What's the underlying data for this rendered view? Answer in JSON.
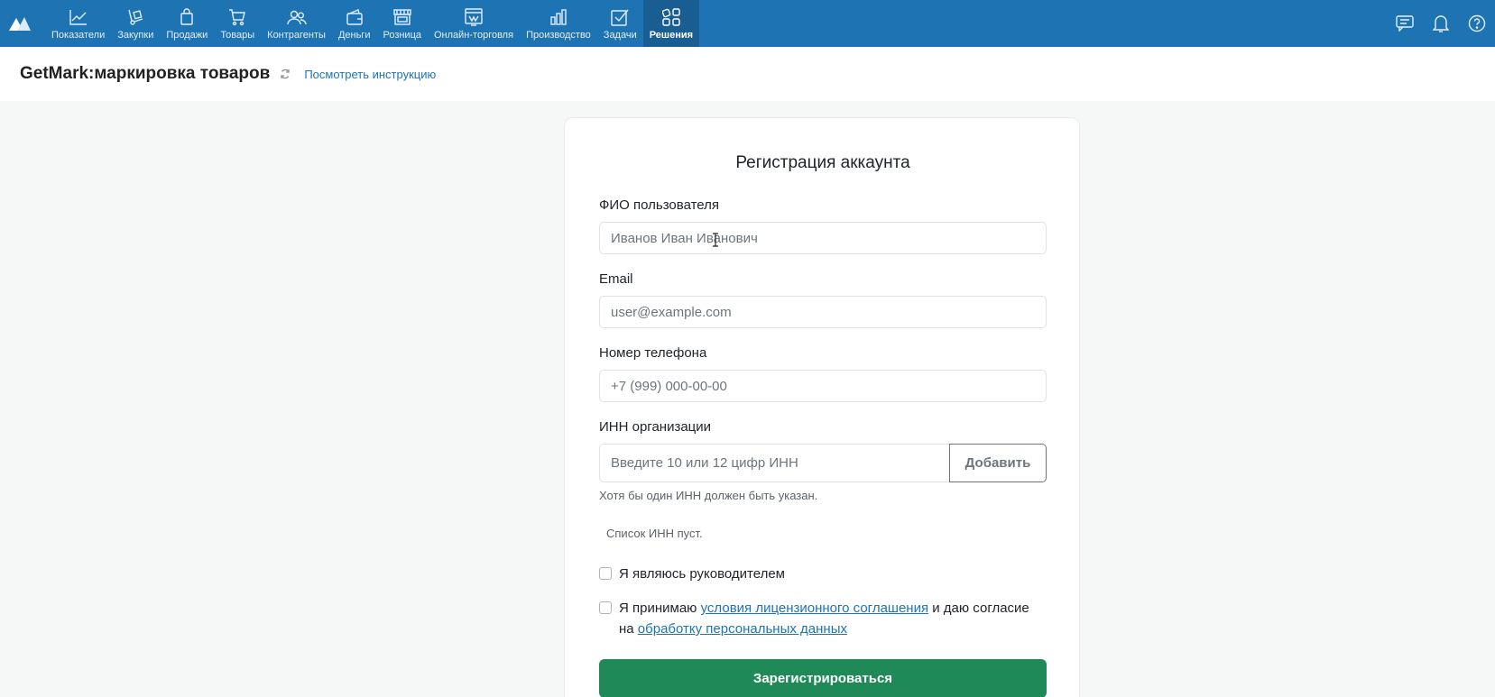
{
  "nav": {
    "items": [
      {
        "label": "Показатели",
        "icon": "chart-line-icon",
        "active": false
      },
      {
        "label": "Закупки",
        "icon": "hand-truck-icon",
        "active": false
      },
      {
        "label": "Продажи",
        "icon": "shopping-bag-icon",
        "active": false
      },
      {
        "label": "Товары",
        "icon": "cart-icon",
        "active": false
      },
      {
        "label": "Контрагенты",
        "icon": "people-icon",
        "active": false
      },
      {
        "label": "Деньги",
        "icon": "wallet-icon",
        "active": false
      },
      {
        "label": "Розница",
        "icon": "store-icon",
        "active": false
      },
      {
        "label": "Онлайн-торговля",
        "icon": "online-store-icon",
        "active": false
      },
      {
        "label": "Производство",
        "icon": "factory-icon",
        "active": false
      },
      {
        "label": "Задачи",
        "icon": "task-check-icon",
        "active": false
      },
      {
        "label": "Решения",
        "icon": "apps-grid-icon",
        "active": true
      }
    ],
    "right_icons": [
      "chat-icon",
      "bell-icon",
      "help-icon"
    ],
    "colors": {
      "bar": "#1e74b3",
      "active": "#185e93"
    }
  },
  "header": {
    "title": "GetMark:маркировка товаров",
    "instruction_link": "Посмотреть инструкцию"
  },
  "form": {
    "title": "Регистрация аккаунта",
    "name_label": "ФИО пользователя",
    "name_placeholder": "Иванов Иван Иванович",
    "email_label": "Email",
    "email_placeholder": "user@example.com",
    "phone_label": "Номер телефона",
    "phone_placeholder": "+7 (999) 000-00-00",
    "inn_label": "ИНН организации",
    "inn_placeholder": "Введите 10 или 12 цифр ИНН",
    "add_button": "Добавить",
    "inn_help": "Хотя бы один ИНН должен быть указан.",
    "inn_list_empty": "Список ИНН пуст.",
    "manager_checkbox_label": "Я являюсь руководителем",
    "agree_prefix": "Я принимаю ",
    "agree_link1": "условия лицензионного соглашения",
    "agree_middle": " и даю согласие на ",
    "agree_link2": "обработку персональных данных",
    "submit_button": "Зарегистрироваться",
    "colors": {
      "submit": "#1f8a57",
      "link": "#1e74b3"
    }
  }
}
